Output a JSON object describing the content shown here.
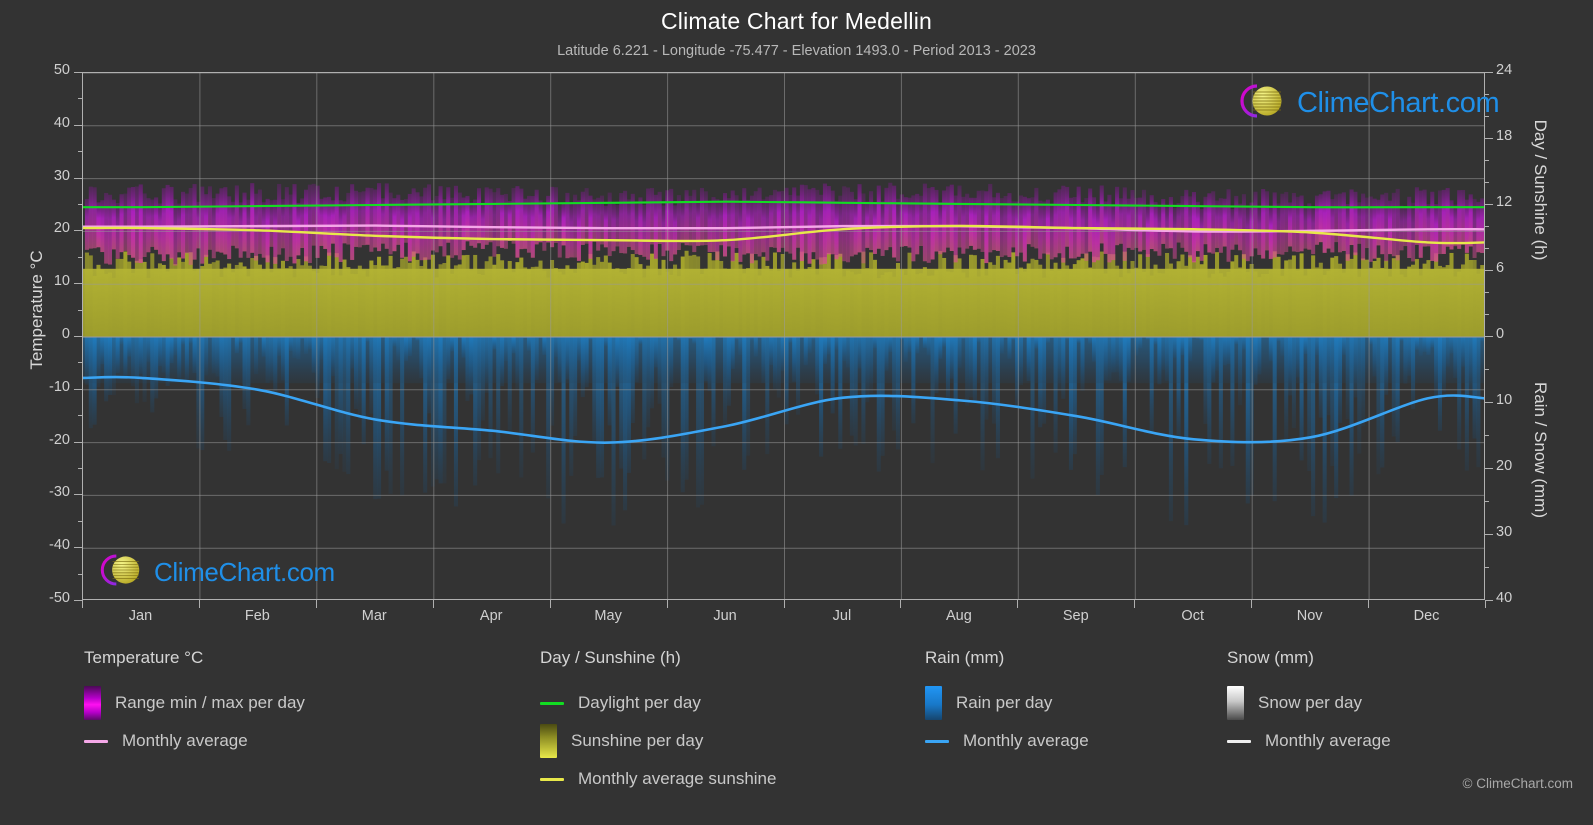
{
  "header": {
    "title": "Climate Chart for Medellin",
    "subtitle": "Latitude 6.221 - Longitude -75.477 - Elevation 1493.0 - Period 2013 - 2023"
  },
  "axes": {
    "left_title": "Temperature °C",
    "right_top_title": "Day / Sunshine (h)",
    "right_bottom_title": "Rain / Snow (mm)",
    "left_ticks": [
      "50",
      "40",
      "30",
      "20",
      "10",
      "0",
      "-10",
      "-20",
      "-30",
      "-40",
      "-50"
    ],
    "right_top_ticks": [
      "24",
      "18",
      "12",
      "6",
      "0"
    ],
    "right_bottom_ticks": [
      "0",
      "10",
      "20",
      "30",
      "40"
    ],
    "x_ticks": [
      "Jan",
      "Feb",
      "Mar",
      "Apr",
      "May",
      "Jun",
      "Jul",
      "Aug",
      "Sep",
      "Oct",
      "Nov",
      "Dec"
    ]
  },
  "legend": {
    "columns": [
      {
        "heading": "Temperature °C",
        "items": [
          {
            "label": "Range min / max per day",
            "swatch": "gradient-box",
            "color": "#ff00e0"
          },
          {
            "label": "Monthly average",
            "swatch": "line",
            "color": "#f5a8e8"
          }
        ]
      },
      {
        "heading": "Day / Sunshine (h)",
        "items": [
          {
            "label": "Daylight per day",
            "swatch": "line",
            "color": "#12dd22"
          },
          {
            "label": "Sunshine per day",
            "swatch": "gradient-box",
            "color": "#e8e84a"
          },
          {
            "label": "Monthly average sunshine",
            "swatch": "line",
            "color": "#e8e84a"
          }
        ]
      },
      {
        "heading": "Rain (mm)",
        "items": [
          {
            "label": "Rain per day",
            "swatch": "gradient-box",
            "color": "#1a8cf0"
          },
          {
            "label": "Monthly average",
            "swatch": "line",
            "color": "#3aa5f5"
          }
        ]
      },
      {
        "heading": "Snow (mm)",
        "items": [
          {
            "label": "Snow per day",
            "swatch": "gradient-box",
            "color": "#f0f0f0"
          },
          {
            "label": "Monthly average",
            "swatch": "line",
            "color": "#f0f0f0"
          }
        ]
      }
    ]
  },
  "branding": {
    "wordmark": "ClimeChart.com",
    "copyright": "© ClimeChart.com"
  },
  "chart_data": {
    "type": "area",
    "title": "Climate Chart for Medellin",
    "subtitle": "Latitude 6.221 - Longitude -75.477 - Elevation 1493.0 - Period 2013 - 2023",
    "location": "Medellin",
    "latitude": 6.221,
    "longitude": -75.477,
    "elevation_m": 1493.0,
    "period": "2013 - 2023",
    "xlabel": "",
    "x_categories": [
      "Jan",
      "Feb",
      "Mar",
      "Apr",
      "May",
      "Jun",
      "Jul",
      "Aug",
      "Sep",
      "Oct",
      "Nov",
      "Dec"
    ],
    "grid": true,
    "legend_position": "below",
    "y_left": {
      "label": "Temperature °C",
      "ylim": [
        -50,
        50
      ],
      "tick_step": 10
    },
    "y_right_top": {
      "label": "Day / Sunshine (h)",
      "ylim": [
        0,
        24
      ],
      "tick_step": 6,
      "maps_to": "0..50 degC half"
    },
    "y_right_bottom": {
      "label": "Rain / Snow (mm)",
      "ylim": [
        0,
        40
      ],
      "tick_step": 10,
      "maps_to": "0..-50 degC half"
    },
    "series": [
      {
        "name": "Monthly average temperature",
        "unit": "°C",
        "axis": "left",
        "style": "line",
        "color": "#f5a8e8",
        "values": [
          20.9,
          21.0,
          21.1,
          20.8,
          20.6,
          20.6,
          21.0,
          21.0,
          20.6,
          20.0,
          20.1,
          20.4
        ]
      },
      {
        "name": "Range max per day (temperature band top)",
        "unit": "°C",
        "axis": "left",
        "style": "band",
        "color": "#c01fd0",
        "values": [
          27.0,
          27.3,
          27.3,
          26.8,
          26.6,
          26.8,
          27.3,
          27.4,
          26.9,
          26.1,
          26.2,
          26.6
        ]
      },
      {
        "name": "Range min per day (temperature band bottom)",
        "unit": "°C",
        "axis": "left",
        "style": "band",
        "color": "#d8478f",
        "values": [
          15.3,
          15.5,
          16.0,
          16.3,
          16.2,
          15.8,
          15.6,
          15.7,
          16.0,
          16.0,
          16.2,
          15.7
        ]
      },
      {
        "name": "Daylight per day",
        "unit": "h",
        "axis": "right_top",
        "style": "line",
        "color": "#12dd22",
        "values": [
          11.8,
          11.9,
          12.0,
          12.1,
          12.2,
          12.3,
          12.2,
          12.1,
          12.0,
          11.9,
          11.8,
          11.8
        ]
      },
      {
        "name": "Monthly average sunshine",
        "unit": "h",
        "axis": "right_top",
        "style": "line",
        "color": "#e8e84a",
        "values": [
          9.9,
          9.7,
          9.2,
          8.9,
          8.8,
          8.8,
          9.8,
          10.1,
          9.9,
          9.8,
          9.5,
          8.6,
          9.3
        ]
      },
      {
        "name": "Sunshine per day",
        "unit": "h",
        "axis": "right_top",
        "style": "area",
        "color": "#a8a82e",
        "values": [
          6.6,
          6.6,
          6.6,
          6.6,
          6.6,
          6.6,
          6.6,
          6.6,
          6.6,
          6.6,
          6.6,
          6.6
        ]
      },
      {
        "name": "Rain monthly average",
        "unit": "mm",
        "axis": "right_bottom",
        "style": "line",
        "color": "#3aa5f5",
        "values": [
          6.2,
          8.0,
          12.5,
          14.2,
          16.0,
          13.5,
          9.2,
          9.6,
          12.0,
          15.5,
          15.2,
          9.3
        ]
      },
      {
        "name": "Rain per day",
        "unit": "mm",
        "axis": "right_bottom",
        "style": "area",
        "color": "#1a6aa8",
        "values": [
          5.5,
          5.5,
          5.5,
          5.5,
          5.5,
          5.5,
          5.5,
          5.5,
          5.5,
          5.5,
          5.5,
          5.5
        ]
      },
      {
        "name": "Snow per day",
        "unit": "mm",
        "axis": "right_bottom",
        "style": "area",
        "color": "#f0f0f0",
        "values": [
          0,
          0,
          0,
          0,
          0,
          0,
          0,
          0,
          0,
          0,
          0,
          0
        ]
      }
    ]
  }
}
